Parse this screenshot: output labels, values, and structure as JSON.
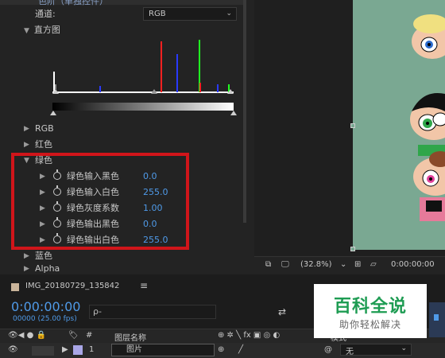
{
  "effect_panel": {
    "top_label": "色阶（单独控件）",
    "channel_label": "通道:",
    "channel_value": "RGB",
    "histogram_label": "直方图",
    "groups": [
      {
        "label": "RGB"
      },
      {
        "label": "红色"
      },
      {
        "label": "绿色"
      },
      {
        "label": "蓝色"
      },
      {
        "label": "Alpha"
      }
    ],
    "green_params": [
      {
        "label": "绿色输入黑色",
        "value": "0.0"
      },
      {
        "label": "绿色输入白色",
        "value": "255.0"
      },
      {
        "label": "绿色灰度系数",
        "value": "1.00"
      },
      {
        "label": "绿色输出黑色",
        "value": "0.0"
      },
      {
        "label": "绿色输出白色",
        "value": "255.0"
      }
    ]
  },
  "viewer": {
    "zoom": "(32.8%)",
    "time": "0:00:00:00"
  },
  "timeline": {
    "comp_name": "IMG_20180729_135842",
    "menu_icon": "≡",
    "timecode": "0:00:00:00",
    "fps": "00000 (25.00 fps)",
    "search_icon": "ρ-",
    "header": {
      "number": "#",
      "layer_name": "图层名称",
      "mode": "模式"
    },
    "layer": {
      "number": "1",
      "name": "图片",
      "mode": "无"
    }
  },
  "watermark": {
    "title": "百科全说",
    "subtitle": "助你轻松解决"
  },
  "colors": {
    "highlight": "#d0151a",
    "value_blue": "#4f9ae8",
    "canvas_bg": "#7aa892",
    "watermark_green": "#1e9c53"
  }
}
